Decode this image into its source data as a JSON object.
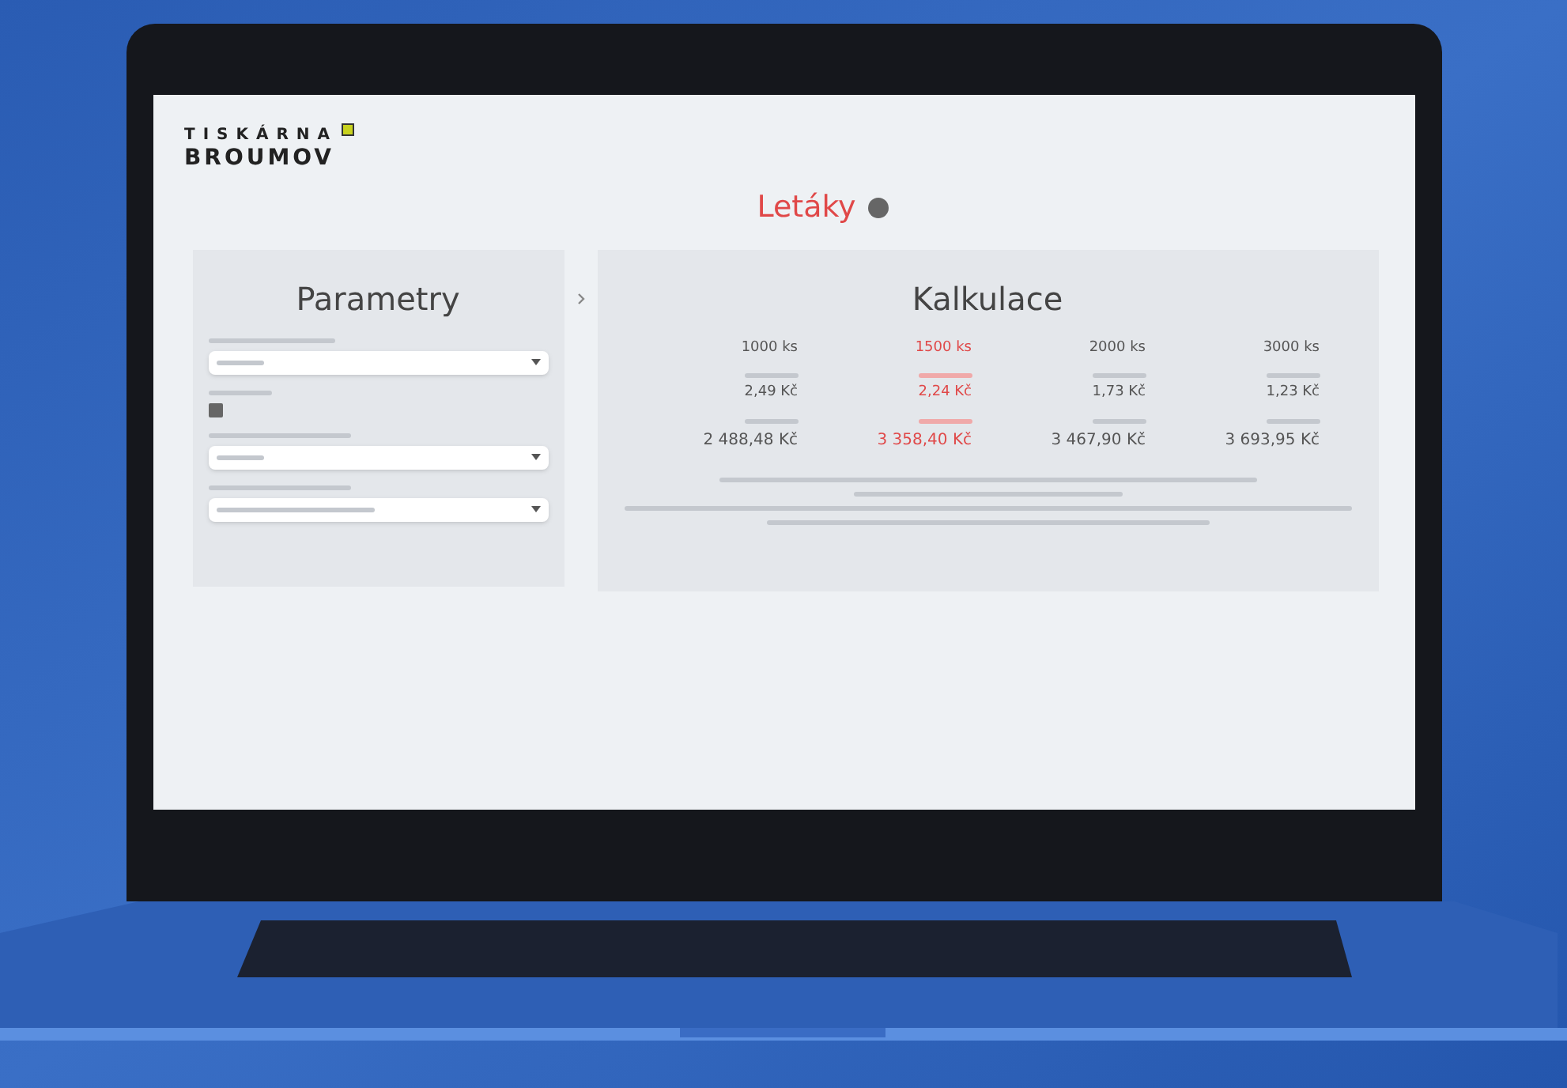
{
  "logo": {
    "line_1": "TISKÁRNA",
    "line_2": "BROUMOV"
  },
  "page_title": "Letáky",
  "parameters": {
    "title": "Parametry",
    "fields": [
      {
        "kind": "select"
      },
      {
        "kind": "check",
        "checked": true
      },
      {
        "kind": "select"
      },
      {
        "kind": "select"
      }
    ]
  },
  "calculation": {
    "title": "Kalkulace",
    "columns": [
      {
        "quantity": "1000 ks",
        "unit_price": "2,49 Kč",
        "total": "2 488,48 Kč",
        "selected": false
      },
      {
        "quantity": "1500 ks",
        "unit_price": "2,24 Kč",
        "total": "3 358,40 Kč",
        "selected": true
      },
      {
        "quantity": "2000 ks",
        "unit_price": "1,73 Kč",
        "total": "3 467,90 Kč",
        "selected": false
      },
      {
        "quantity": "3000 ks",
        "unit_price": "1,23 Kč",
        "total": "3 693,95 Kč",
        "selected": false
      }
    ]
  }
}
